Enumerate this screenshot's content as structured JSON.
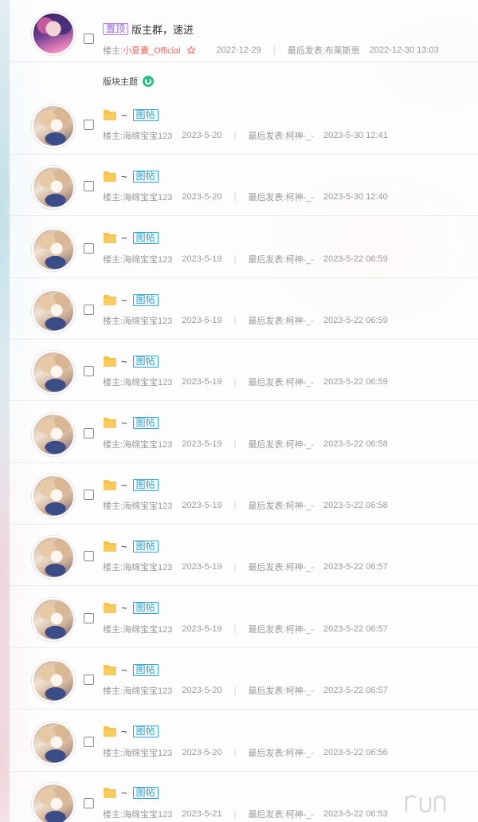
{
  "pinned": {
    "tag": "置顶",
    "title": "版主群，速进",
    "author_prefix": "楼主: ",
    "author": "小夏囊_Official",
    "date": "2022-12-29",
    "last_prefix": "最后发表: ",
    "last_user": "布莱斯恩",
    "last_time": "2022-12-30 13:03"
  },
  "section_label": "版块主题",
  "tag_picture": "图帖",
  "threads": [
    {
      "title": "~",
      "author_prefix": "楼主: ",
      "author": "海绵宝宝123",
      "date": "2023-5-20",
      "last_prefix": "最后发表: ",
      "last_user": "柯神-_-",
      "last_time": "2023-5-30 12:41"
    },
    {
      "title": "~",
      "author_prefix": "楼主: ",
      "author": "海绵宝宝123",
      "date": "2023-5-20",
      "last_prefix": "最后发表: ",
      "last_user": "柯神-_-",
      "last_time": "2023-5-30 12:40"
    },
    {
      "title": "~",
      "author_prefix": "楼主: ",
      "author": "海绵宝宝123",
      "date": "2023-5-19",
      "last_prefix": "最后发表: ",
      "last_user": "柯神-_-",
      "last_time": "2023-5-22 06:59"
    },
    {
      "title": "~",
      "author_prefix": "楼主: ",
      "author": "海绵宝宝123",
      "date": "2023-5-19",
      "last_prefix": "最后发表: ",
      "last_user": "柯神-_-",
      "last_time": "2023-5-22 06:59"
    },
    {
      "title": "~",
      "author_prefix": "楼主: ",
      "author": "海绵宝宝123",
      "date": "2023-5-19",
      "last_prefix": "最后发表: ",
      "last_user": "柯神-_-",
      "last_time": "2023-5-22 06:59"
    },
    {
      "title": "~",
      "author_prefix": "楼主: ",
      "author": "海绵宝宝123",
      "date": "2023-5-19",
      "last_prefix": "最后发表: ",
      "last_user": "柯神-_-",
      "last_time": "2023-5-22 06:58"
    },
    {
      "title": "~",
      "author_prefix": "楼主: ",
      "author": "海绵宝宝123",
      "date": "2023-5-19",
      "last_prefix": "最后发表: ",
      "last_user": "柯神-_-",
      "last_time": "2023-5-22 06:58"
    },
    {
      "title": "~",
      "author_prefix": "楼主: ",
      "author": "海绵宝宝123",
      "date": "2023-5-19",
      "last_prefix": "最后发表: ",
      "last_user": "柯神-_-",
      "last_time": "2023-5-22 06:57"
    },
    {
      "title": "~",
      "author_prefix": "楼主: ",
      "author": "海绵宝宝123",
      "date": "2023-5-19",
      "last_prefix": "最后发表: ",
      "last_user": "柯神-_-",
      "last_time": "2023-5-22 06:57"
    },
    {
      "title": "~",
      "author_prefix": "楼主: ",
      "author": "海绵宝宝123",
      "date": "2023-5-20",
      "last_prefix": "最后发表: ",
      "last_user": "柯神-_-",
      "last_time": "2023-5-22 06:57"
    },
    {
      "title": "~",
      "author_prefix": "楼主: ",
      "author": "海绵宝宝123",
      "date": "2023-5-20",
      "last_prefix": "最后发表: ",
      "last_user": "柯神-_-",
      "last_time": "2023-5-22 06:56"
    },
    {
      "title": "~",
      "author_prefix": "楼主: ",
      "author": "海绵宝宝123",
      "date": "2023-5-21",
      "last_prefix": "最后发表: ",
      "last_user": "柯神-_-",
      "last_time": "2023-5-22 06:53"
    }
  ],
  "icons": {
    "folder": "folder-icon",
    "refresh": "refresh-icon",
    "badge": "honor-badge-icon"
  },
  "colors": {
    "folder": "#f6c04c",
    "tag_pin": "#9a6ad8",
    "tag_picture": "#2ea3cf",
    "author_highlight": "#f06a5f",
    "refresh": "#2bbf8a"
  }
}
